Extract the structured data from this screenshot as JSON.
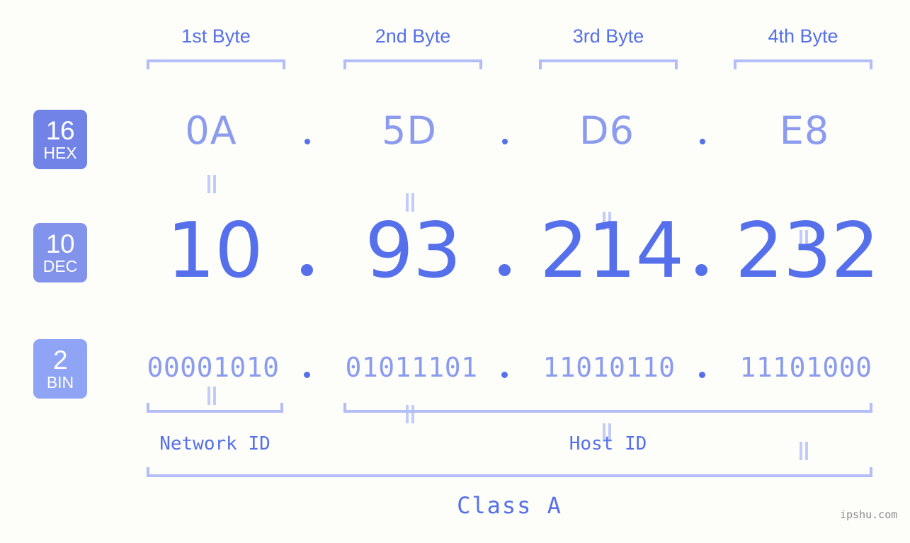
{
  "meta": {
    "background": "#fdfdfa",
    "accent_strong": "#5570ea",
    "accent_light": "#8b9bee",
    "accent_pale": "#b3bdf7",
    "watermark": "ipshu.com"
  },
  "byte_headers": [
    {
      "label": "1st Byte"
    },
    {
      "label": "2nd Byte"
    },
    {
      "label": "3rd Byte"
    },
    {
      "label": "4th Byte"
    }
  ],
  "bases": [
    {
      "number": "16",
      "name": "HEX",
      "color": "#7283e8"
    },
    {
      "number": "10",
      "name": "DEC",
      "color": "#8293ec"
    },
    {
      "number": "2",
      "name": "BIN",
      "color": "#8fa4f4"
    }
  ],
  "separator": ".",
  "rows": {
    "hex": {
      "base_number": "16",
      "base_name": "HEX",
      "octets": [
        "0A",
        "5D",
        "D6",
        "E8"
      ]
    },
    "dec": {
      "base_number": "10",
      "base_name": "DEC",
      "octets": [
        "10",
        "93",
        "214",
        "232"
      ]
    },
    "bin": {
      "base_number": "2",
      "base_name": "BIN",
      "octets": [
        "00001010",
        "01011101",
        "11010110",
        "11101000"
      ]
    }
  },
  "equality_symbol": "=",
  "segments": {
    "network_id": {
      "label": "Network ID"
    },
    "host_id": {
      "label": "Host ID"
    },
    "class": {
      "label": "Class A"
    }
  },
  "ip": {
    "hex": "0A.5D.D6.E8",
    "dec": "10.93.214.232",
    "bin": "00001010.01011101.11010110.11101000"
  }
}
